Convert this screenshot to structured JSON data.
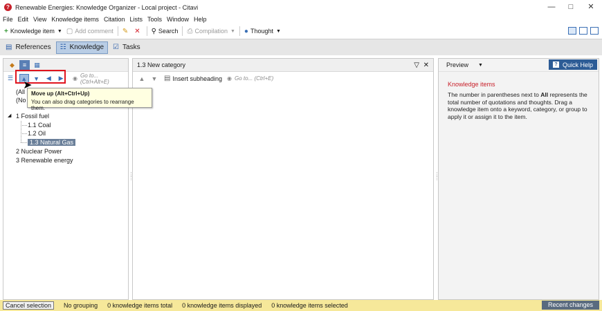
{
  "window": {
    "title": "Renewable Energies: Knowledge Organizer - Local project - Citavi"
  },
  "menu": [
    "File",
    "Edit",
    "View",
    "Knowledge items",
    "Citation",
    "Lists",
    "Tools",
    "Window",
    "Help"
  ],
  "toolbar": {
    "knowledge_item": "Knowledge item",
    "add_comment": "Add comment",
    "search": "Search",
    "compilation": "Compilation",
    "thought": "Thought"
  },
  "sections": {
    "references": "References",
    "knowledge": "Knowledge",
    "tasks": "Tasks"
  },
  "left": {
    "goto_placeholder": "Go to... (Ctrl+Alt+E)",
    "all_partial": "(All",
    "no_partial": "(No c",
    "tree": [
      {
        "label": "1 Fossil fuel"
      },
      {
        "label": "1.1 Coal"
      },
      {
        "label": "1.2 Oil"
      },
      {
        "label": "1.3 Natural Gas"
      },
      {
        "label": "2 Nuclear Power"
      },
      {
        "label": "3 Renewable energy"
      }
    ]
  },
  "tooltip": {
    "title": "Move up (Alt+Ctrl+Up)",
    "body": "You can also drag categories to rearrange them."
  },
  "middle": {
    "header": "1.3 New category",
    "insert_subheading": "Insert subheading",
    "goto_placeholder": "Go to... (Ctrl+E)"
  },
  "right": {
    "preview": "Preview",
    "quick_help": "Quick Help",
    "kn_title": "Knowledge items",
    "kn_text_1": "The number in parentheses next to ",
    "kn_text_bold": "All",
    "kn_text_2": " represents the total number of quotations and thoughts. Drag a knowledge item onto a keyword, category, or group to apply it or assign it to the item."
  },
  "status": {
    "cancel_selection": "Cancel selection",
    "grouping": "No grouping",
    "total": "0 knowledge items total",
    "displayed": "0 knowledge items displayed",
    "selected": "0 knowledge items selected",
    "recent_changes": "Recent changes"
  },
  "colors": {
    "accent": "#2d5c96",
    "highlight": "#e0141e",
    "statusbar": "#f6e89a"
  }
}
